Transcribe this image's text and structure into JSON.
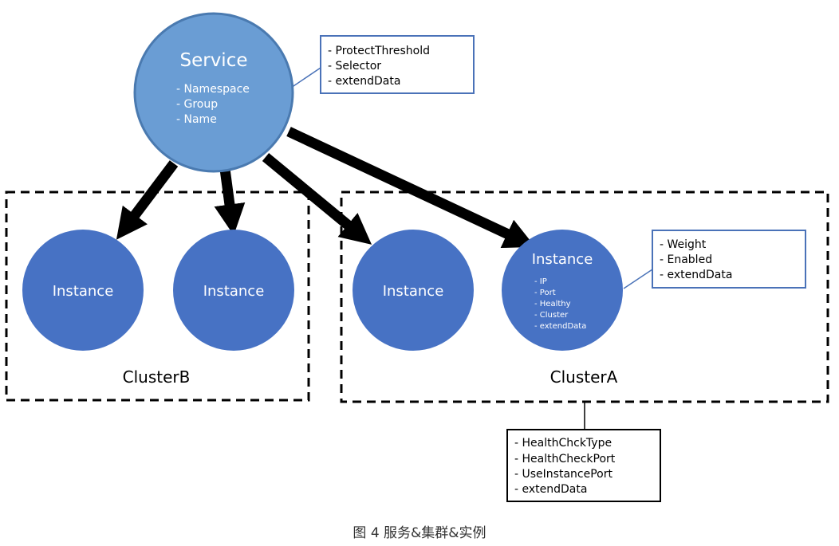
{
  "service": {
    "title": "Service",
    "fields": [
      "- Namespace",
      "- Group",
      "- Name"
    ],
    "note": [
      "- ProtectThreshold",
      "- Selector",
      "- extendData"
    ]
  },
  "instances": [
    {
      "title": "Instance"
    },
    {
      "title": "Instance"
    },
    {
      "title": "Instance"
    },
    {
      "title": "Instance",
      "fields": [
        "- IP",
        "- Port",
        "- Healthy",
        "- Cluster",
        "- extendData"
      ]
    }
  ],
  "instance_note": [
    "- Weight",
    "- Enabled",
    "- extendData"
  ],
  "clusters": {
    "b_label": "ClusterB",
    "a_label": "ClusterA"
  },
  "cluster_note": [
    "- HealthChckType",
    "- HealthCheckPort",
    "- UseInstancePort",
    "- extendData"
  ],
  "caption": "图 4  服务&集群&实例",
  "colors": {
    "service_fill": "#6a9dd4",
    "service_stroke": "#4a7ab0",
    "instance_fill": "#4772c4",
    "note_border_blue": "#4a72b8",
    "note_border_dark": "#000000",
    "arrow": "#000000"
  }
}
